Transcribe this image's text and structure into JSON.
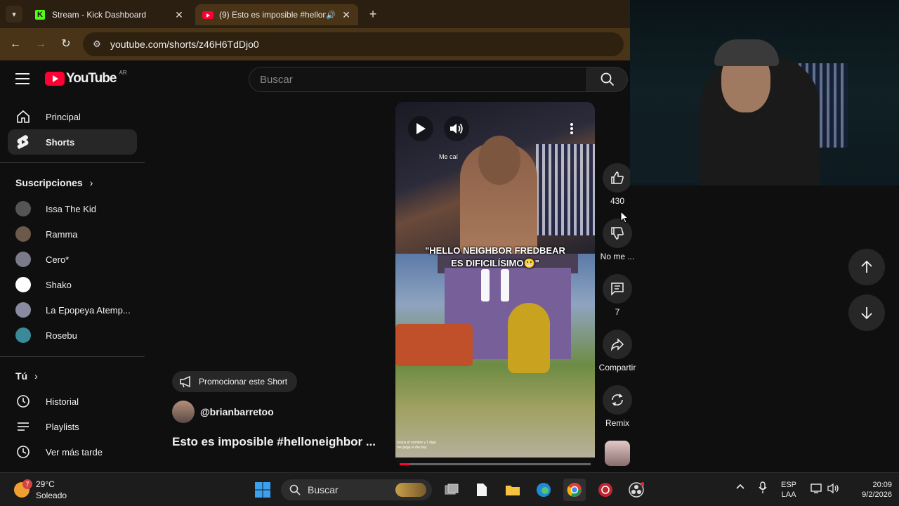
{
  "browser": {
    "tabs": [
      {
        "title": "Stream - Kick Dashboard"
      },
      {
        "title": "(9) Esto es imposible #hellon"
      }
    ],
    "url": "youtube.com/shorts/z46H6TdDjo0"
  },
  "youtube": {
    "logo_text": "YouTube",
    "region": "AR",
    "search_placeholder": "Buscar"
  },
  "sidebar": {
    "main": [
      {
        "label": "Principal"
      },
      {
        "label": "Shorts"
      }
    ],
    "subscriptions_title": "Suscripciones",
    "subscriptions": [
      {
        "label": "Issa The Kid",
        "color": "#555555"
      },
      {
        "label": "Ramma",
        "color": "#6b5a4a"
      },
      {
        "label": "Cero*",
        "color": "#7a7a8a"
      },
      {
        "label": "Shako",
        "color": "#ffffff"
      },
      {
        "label": "La Epopeya Atemp...",
        "color": "#8a8aa0"
      },
      {
        "label": "Rosebu",
        "color": "#3a8a9a"
      }
    ],
    "you_title": "Tú",
    "you": [
      {
        "label": "Historial"
      },
      {
        "label": "Playlists"
      },
      {
        "label": "Ver más tarde"
      }
    ]
  },
  "short": {
    "caption_line1": "\"HELLO NEIGHBOR FREDBEAR",
    "caption_line2": "ES DIFICILÍSIMO😬\"",
    "overlay_small": "Me caí",
    "overlay_bottom1": "busca el nombre y 1 digo",
    "overlay_bottom2": "me pega el dia hoy",
    "progress": 0.05,
    "promote_label": "Promocionar este Short",
    "channel": "@brianbarretoo",
    "title": "Esto es imposible #helloneighbor ..."
  },
  "actions": {
    "likes": "430",
    "dislike_label": "No me ...",
    "comments": "7",
    "share_label": "Compartir",
    "remix_label": "Remix"
  },
  "taskbar": {
    "temp": "29°C",
    "weather": "Soleado",
    "weather_badge": "7",
    "search_label": "Buscar",
    "lang1": "ESP",
    "lang2": "LAA",
    "time": "20:09",
    "date": "9/2/2026"
  }
}
